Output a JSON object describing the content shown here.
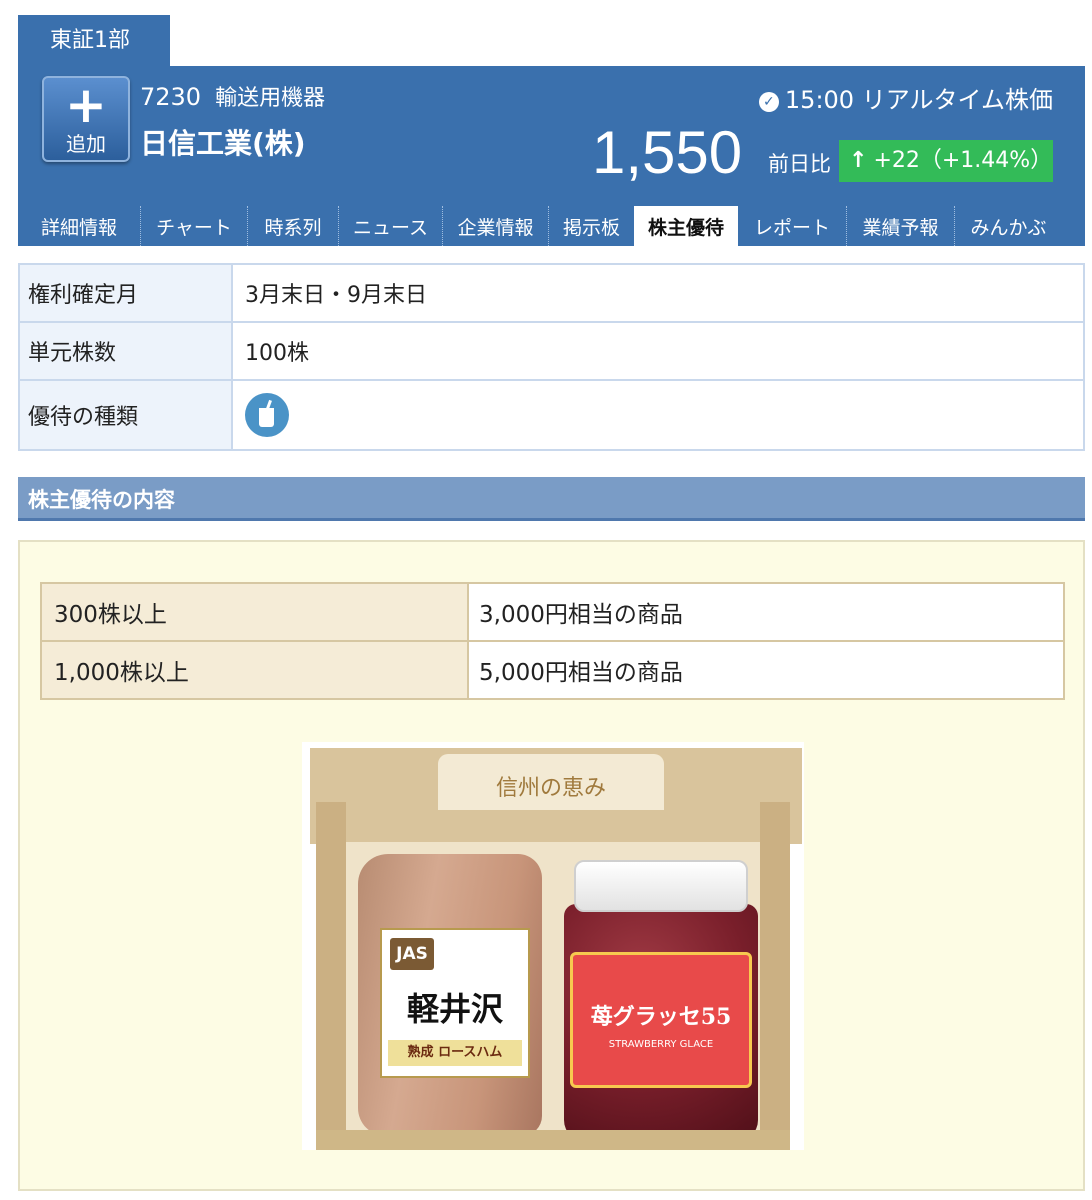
{
  "market": "東証1部",
  "stock": {
    "add_label": "追加",
    "code": "7230",
    "industry": "輸送用機器",
    "name": "日信工業(株)",
    "time": "15:00",
    "realtime_label": "リアルタイム株価",
    "price": "1,550",
    "prev_label": "前日比",
    "change": "+22（+1.44%）",
    "change_color": "#33bb58",
    "header_color": "#3a70ad"
  },
  "nav": {
    "items": [
      {
        "label": "詳細情報"
      },
      {
        "label": "チャート"
      },
      {
        "label": "時系列"
      },
      {
        "label": "ニュース"
      },
      {
        "label": "企業情報"
      },
      {
        "label": "掲示板"
      },
      {
        "label": "株主優待"
      },
      {
        "label": "レポート"
      },
      {
        "label": "業績予報"
      },
      {
        "label": "みんかぶ"
      }
    ],
    "active": "株主優待"
  },
  "info": {
    "rows": [
      {
        "label": "権利確定月",
        "value": "3月末日・9月末日"
      },
      {
        "label": "単元株数",
        "value": "100株"
      },
      {
        "label": "優待の種類",
        "icon": "drink-icon"
      }
    ]
  },
  "section": {
    "title": "株主優待の内容"
  },
  "tiers": [
    {
      "shares": "300株以上",
      "benefit": "3,000円相当の商品"
    },
    {
      "shares": "1,000株以上",
      "benefit": "5,000円相当の商品"
    }
  ],
  "product_image": {
    "box_brand": "信州の恵み",
    "ham_logo": "JAS",
    "ham_name": "軽井沢",
    "ham_subtitle": "熟成 ロースハム",
    "jar_name": "苺グラッセ55",
    "jar_subtitle": "STRAWBERRY GLACE"
  }
}
